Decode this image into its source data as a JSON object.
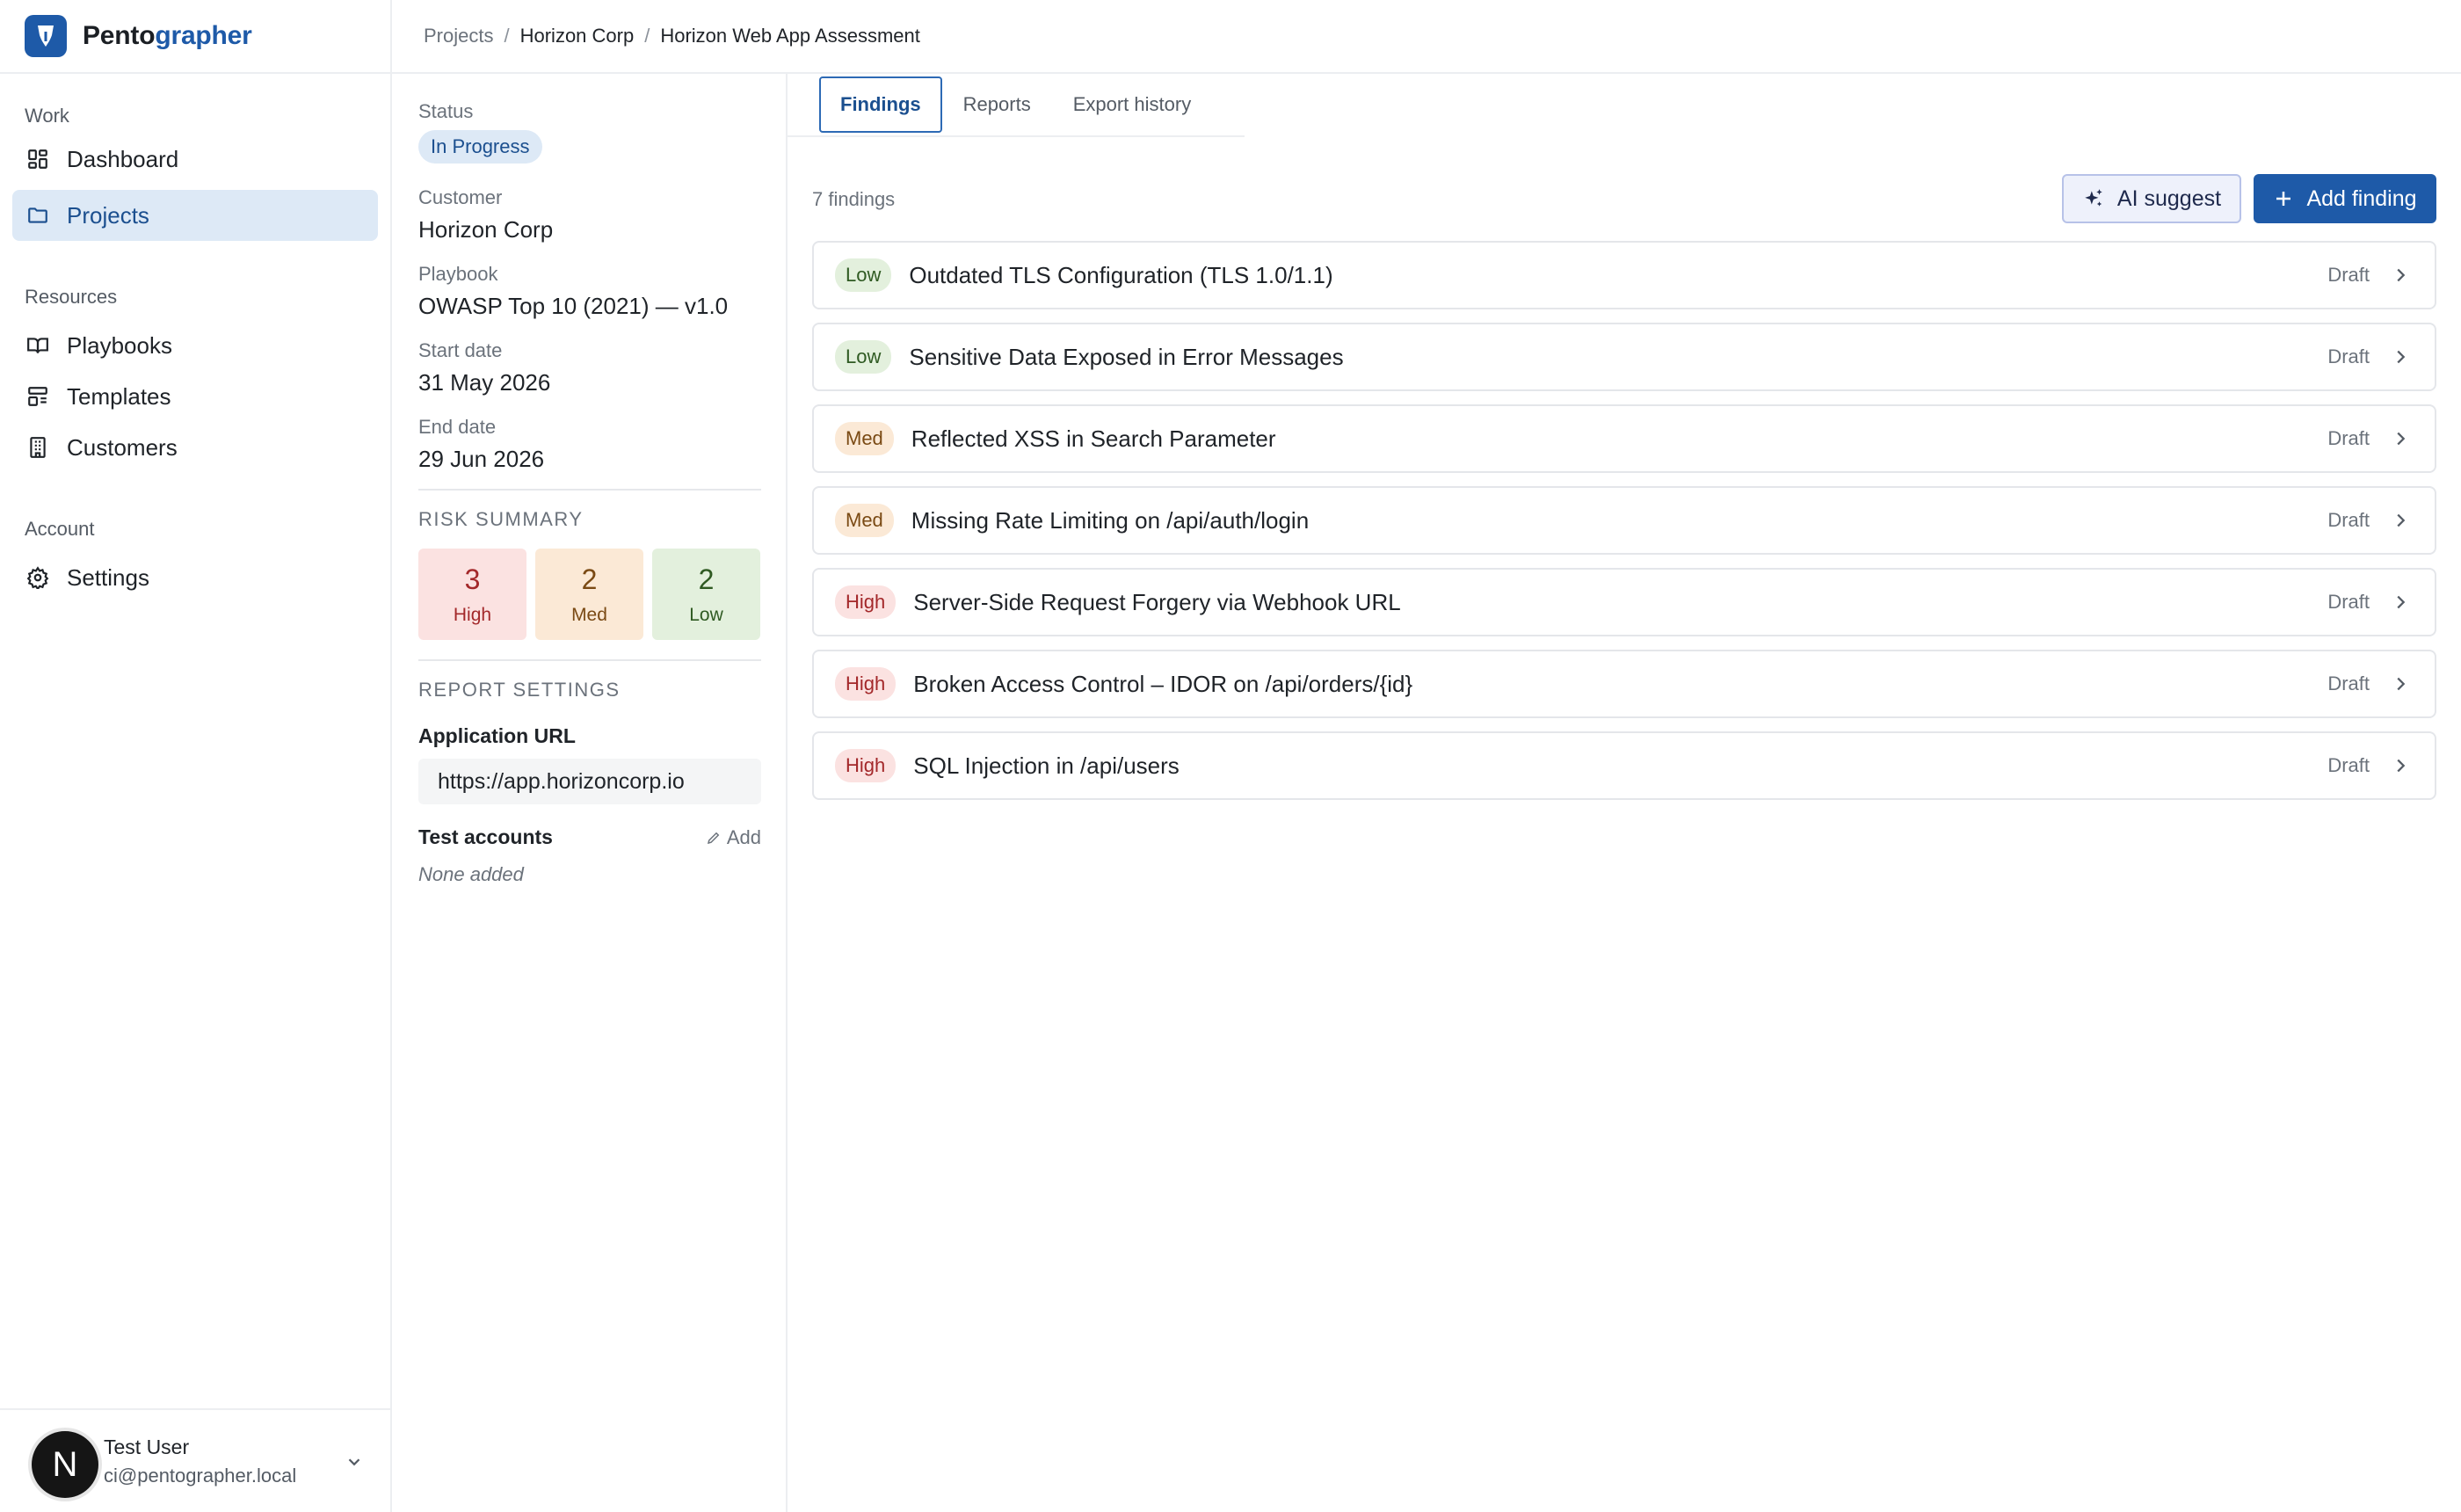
{
  "brand": {
    "name_part1": "Pento",
    "name_part2": "grapher",
    "accent": "#1e5aa8"
  },
  "breadcrumb": {
    "items": [
      "Projects",
      "Horizon Corp",
      "Horizon Web App Assessment"
    ],
    "separator": "/"
  },
  "sidebar": {
    "sections": [
      {
        "heading": "Work",
        "items": [
          {
            "label": "Dashboard",
            "icon": "dashboard-icon",
            "active": false
          },
          {
            "label": "Projects",
            "icon": "folder-icon",
            "active": true
          }
        ]
      },
      {
        "heading": "Resources",
        "items": [
          {
            "label": "Playbooks",
            "icon": "book-icon",
            "active": false
          },
          {
            "label": "Templates",
            "icon": "template-icon",
            "active": false
          },
          {
            "label": "Customers",
            "icon": "building-icon",
            "active": false
          }
        ]
      },
      {
        "heading": "Account",
        "items": [
          {
            "label": "Settings",
            "icon": "gear-icon",
            "active": false
          }
        ]
      }
    ]
  },
  "user": {
    "avatar_letter": "N",
    "name": "Test User",
    "email": "ci@pentographer.local"
  },
  "details": {
    "status_label": "Status",
    "status_value": "In Progress",
    "customer_label": "Customer",
    "customer_value": "Horizon Corp",
    "playbook_label": "Playbook",
    "playbook_value": "OWASP Top 10 (2021) — v1.0",
    "start_label": "Start date",
    "start_value": "31 May 2026",
    "end_label": "End date",
    "end_value": "29 Jun 2026",
    "risk_heading": "RISK SUMMARY",
    "risk": {
      "high_count": "3",
      "high_label": "High",
      "med_count": "2",
      "med_label": "Med",
      "low_count": "2",
      "low_label": "Low"
    },
    "report_heading": "REPORT SETTINGS",
    "app_url_label": "Application URL",
    "app_url_value": "https://app.horizoncorp.io",
    "test_accounts_label": "Test accounts",
    "test_accounts_add": "Add",
    "test_accounts_empty": "None added"
  },
  "tabs": [
    {
      "label": "Findings",
      "active": true
    },
    {
      "label": "Reports",
      "active": false
    },
    {
      "label": "Export history",
      "active": false
    }
  ],
  "findings_header": {
    "count_text": "7 findings",
    "ai_button": "AI suggest",
    "add_button": "Add finding"
  },
  "findings": [
    {
      "severity": "Low",
      "level": "low",
      "title": "Outdated TLS Configuration (TLS 1.0/1.1)",
      "state": "Draft"
    },
    {
      "severity": "Low",
      "level": "low",
      "title": "Sensitive Data Exposed in Error Messages",
      "state": "Draft"
    },
    {
      "severity": "Med",
      "level": "med",
      "title": "Reflected XSS in Search Parameter",
      "state": "Draft"
    },
    {
      "severity": "Med",
      "level": "med",
      "title": "Missing Rate Limiting on /api/auth/login",
      "state": "Draft"
    },
    {
      "severity": "High",
      "level": "high",
      "title": "Server-Side Request Forgery via Webhook URL",
      "state": "Draft"
    },
    {
      "severity": "High",
      "level": "high",
      "title": "Broken Access Control – IDOR on /api/orders/{id}",
      "state": "Draft"
    },
    {
      "severity": "High",
      "level": "high",
      "title": "SQL Injection in /api/users",
      "state": "Draft"
    }
  ]
}
